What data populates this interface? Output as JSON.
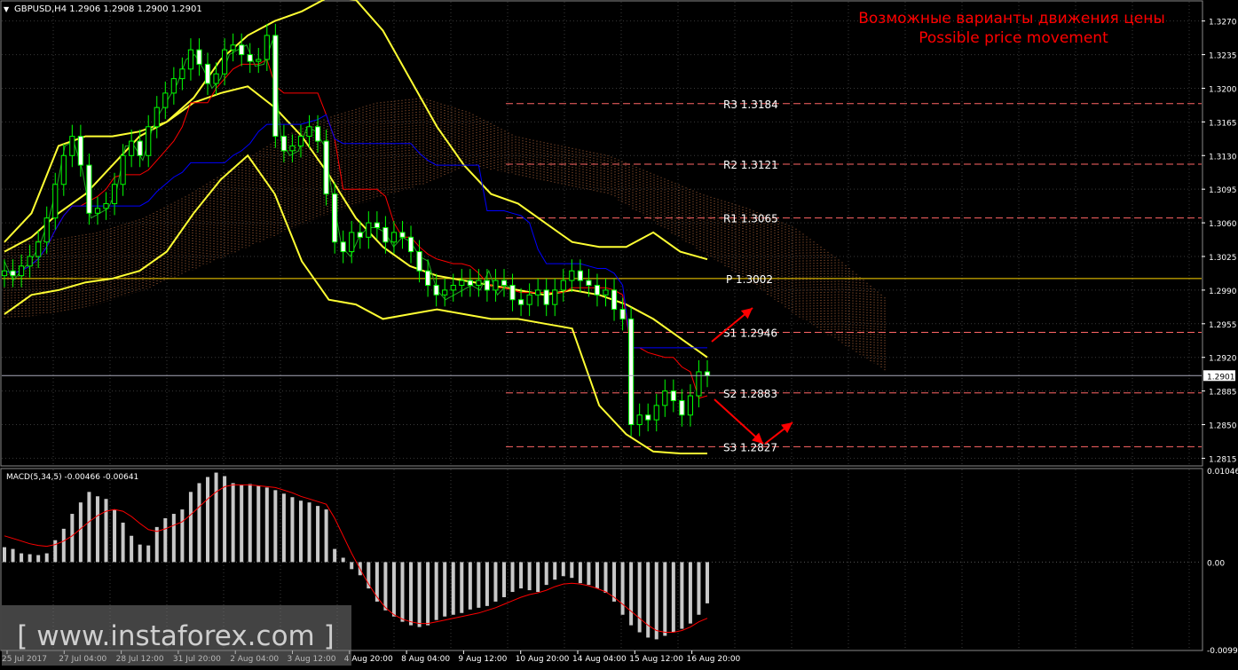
{
  "header": {
    "symbol_line": "GBPUSD,H4  1.2906 1.2908 1.2900 1.2901",
    "title_ru": "Возможные варианты движения цены",
    "title_en": "Possible price movement"
  },
  "colors": {
    "background": "#000000",
    "grid": "#3a3a3a",
    "axis_text": "#ffffff",
    "candle_bull": "#00ff00",
    "candle_bear_body": "#ffffff",
    "bollinger": "#ffff33",
    "tenkan": "#ff0000",
    "kijun": "#0000ff",
    "chikou": "#22aa22",
    "cloud": "#cc7744",
    "pivot_lines": "#ff6666",
    "pivot_p_line": "#ffd700",
    "arrows": "#ff0000",
    "title": "#ff0000",
    "macd_hist": "#c8c8c8",
    "macd_signal": "#ff0000",
    "watermark": "#7a7a7a"
  },
  "price_axis": {
    "ticks": [
      "1.3270",
      "1.3235",
      "1.3200",
      "1.3165",
      "1.3130",
      "1.3095",
      "1.3060",
      "1.3025",
      "1.2990",
      "1.2955",
      "1.2920",
      "1.2885",
      "1.2850",
      "1.2815"
    ],
    "current_price": "1.2901"
  },
  "time_axis": {
    "labels": [
      "25 Jul 2017",
      "27 Jul 04:00",
      "28 Jul 12:00",
      "31 Jul 20:00",
      "2 Aug 04:00",
      "3 Aug 12:00",
      "4 Aug 20:00",
      "8 Aug 04:00",
      "9 Aug 12:00",
      "10 Aug 20:00",
      "14 Aug 04:00",
      "15 Aug 12:00",
      "16 Aug 20:00"
    ]
  },
  "pivots": [
    {
      "label": "R3",
      "value": "1.3184"
    },
    {
      "label": "R2",
      "value": "1.3121"
    },
    {
      "label": "R1",
      "value": "1.3065"
    },
    {
      "label": "P",
      "value": "1.3002"
    },
    {
      "label": "S1",
      "value": "1.2946"
    },
    {
      "label": "S2",
      "value": "1.2883"
    },
    {
      "label": "S3",
      "value": "1.2827"
    }
  ],
  "macd": {
    "label": "MACD(5,34,5) -0.00466 -0.00641",
    "ticks": [
      "0.01046",
      "0.00",
      "-0.00997"
    ]
  },
  "watermark": "[ www.instaforex.com ]",
  "chart_data": {
    "type": "candlestick",
    "symbol": "GBPUSD",
    "timeframe": "H4",
    "ohlc_last": {
      "open": 1.2906,
      "high": 1.2908,
      "low": 1.29,
      "close": 1.2901
    },
    "ylim": [
      1.2808,
      1.329
    ],
    "close_series": [
      1.301,
      1.3005,
      1.3015,
      1.3025,
      1.304,
      1.3065,
      1.31,
      1.313,
      1.315,
      1.312,
      1.307,
      1.3075,
      1.308,
      1.31,
      1.313,
      1.3145,
      1.313,
      1.316,
      1.318,
      1.3195,
      1.321,
      1.322,
      1.324,
      1.3225,
      1.3205,
      1.3215,
      1.324,
      1.3245,
      1.3235,
      1.3228,
      1.323,
      1.3255,
      1.315,
      1.3135,
      1.314,
      1.315,
      1.316,
      1.3145,
      1.309,
      1.304,
      1.303,
      1.305,
      1.3045,
      1.306,
      1.3055,
      1.304,
      1.305,
      1.3045,
      1.303,
      1.301,
      1.2995,
      1.2985,
      1.299,
      1.2995,
      1.3,
      1.2995,
      1.3,
      1.299,
      1.3,
      1.2995,
      1.298,
      1.2975,
      1.2985,
      1.299,
      1.2975,
      1.299,
      1.3,
      1.301,
      1.3,
      1.2995,
      1.2985,
      1.299,
      1.297,
      1.296,
      1.285,
      1.286,
      1.2855,
      1.287,
      1.2885,
      1.2875,
      1.286,
      1.288,
      1.2905,
      1.2901
    ],
    "bollinger": {
      "upper": [
        1.304,
        1.307,
        1.314,
        1.315,
        1.315,
        1.3155,
        1.3165,
        1.319,
        1.323,
        1.3255,
        1.327,
        1.328,
        1.3295,
        1.3292,
        1.326,
        1.321,
        1.316,
        1.312,
        1.309,
        1.308,
        1.306,
        1.304,
        1.3035,
        1.3035,
        1.305,
        1.303,
        1.3022
      ],
      "middle": [
        1.303,
        1.3045,
        1.307,
        1.309,
        1.312,
        1.315,
        1.3165,
        1.3185,
        1.3195,
        1.3202,
        1.318,
        1.315,
        1.311,
        1.3065,
        1.3035,
        1.3015,
        1.3005,
        1.3,
        1.2995,
        1.299,
        1.2985,
        1.299,
        1.2985,
        1.2975,
        1.296,
        1.294,
        1.292
      ],
      "lower": [
        1.2965,
        1.2985,
        1.299,
        1.2998,
        1.3002,
        1.301,
        1.303,
        1.307,
        1.3105,
        1.313,
        1.309,
        1.302,
        1.298,
        1.2975,
        1.296,
        1.2965,
        1.297,
        1.2965,
        1.296,
        1.296,
        1.2955,
        1.295,
        1.287,
        1.284,
        1.2822,
        1.282,
        1.282
      ]
    },
    "pivots": [
      {
        "name": "R3",
        "value": 1.3184
      },
      {
        "name": "R2",
        "value": 1.3121
      },
      {
        "name": "R1",
        "value": 1.3065
      },
      {
        "name": "P",
        "value": 1.3002
      },
      {
        "name": "S1",
        "value": 1.2946
      },
      {
        "name": "S2",
        "value": 1.2883
      },
      {
        "name": "S3",
        "value": 1.2827
      }
    ],
    "macd": {
      "histogram": [
        0.0017,
        0.0015,
        0.001,
        0.0009,
        0.0008,
        0.001,
        0.0025,
        0.0038,
        0.0055,
        0.0068,
        0.008,
        0.0075,
        0.0072,
        0.006,
        0.0045,
        0.003,
        0.002,
        0.0019,
        0.004,
        0.005,
        0.0055,
        0.006,
        0.008,
        0.009,
        0.0097,
        0.0102,
        0.0098,
        0.009,
        0.0088,
        0.0089,
        0.0087,
        0.0085,
        0.0082,
        0.0078,
        0.0074,
        0.007,
        0.0068,
        0.0064,
        0.006,
        0.0015,
        0.0005,
        -0.0008,
        -0.0015,
        -0.003,
        -0.0045,
        -0.0055,
        -0.0062,
        -0.0068,
        -0.0072,
        -0.0074,
        -0.0072,
        -0.0066,
        -0.0062,
        -0.006,
        -0.0058,
        -0.0054,
        -0.0052,
        -0.005,
        -0.0045,
        -0.004,
        -0.0034,
        -0.003,
        -0.0032,
        -0.0034,
        -0.0026,
        -0.002,
        -0.0016,
        -0.0018,
        -0.0024,
        -0.0026,
        -0.003,
        -0.0035,
        -0.0045,
        -0.006,
        -0.0072,
        -0.008,
        -0.0086,
        -0.0088,
        -0.0084,
        -0.008,
        -0.0076,
        -0.007,
        -0.006,
        -0.0047
      ],
      "signal": [
        0.003,
        0.0027,
        0.0024,
        0.0021,
        0.0019,
        0.0018,
        0.002,
        0.0024,
        0.003,
        0.0038,
        0.0046,
        0.0053,
        0.0058,
        0.006,
        0.0058,
        0.0052,
        0.0044,
        0.0037,
        0.0035,
        0.0038,
        0.0042,
        0.0046,
        0.0054,
        0.0063,
        0.0072,
        0.008,
        0.0086,
        0.0088,
        0.0088,
        0.0088,
        0.0087,
        0.0086,
        0.0085,
        0.0082,
        0.0079,
        0.0075,
        0.0072,
        0.0069,
        0.0066,
        0.005,
        0.003,
        0.001,
        -0.0008,
        -0.0025,
        -0.004,
        -0.0052,
        -0.006,
        -0.0065,
        -0.0068,
        -0.007,
        -0.007,
        -0.0068,
        -0.0066,
        -0.0064,
        -0.0062,
        -0.006,
        -0.0058,
        -0.0055,
        -0.0052,
        -0.0048,
        -0.0044,
        -0.004,
        -0.0037,
        -0.0035,
        -0.0032,
        -0.0028,
        -0.0025,
        -0.0024,
        -0.0025,
        -0.0027,
        -0.003,
        -0.0034,
        -0.004,
        -0.0048,
        -0.0056,
        -0.0064,
        -0.0072,
        -0.0078,
        -0.008,
        -0.008,
        -0.0078,
        -0.0074,
        -0.0068,
        -0.0064
      ],
      "ylim": [
        -0.00997,
        0.01046
      ]
    }
  }
}
